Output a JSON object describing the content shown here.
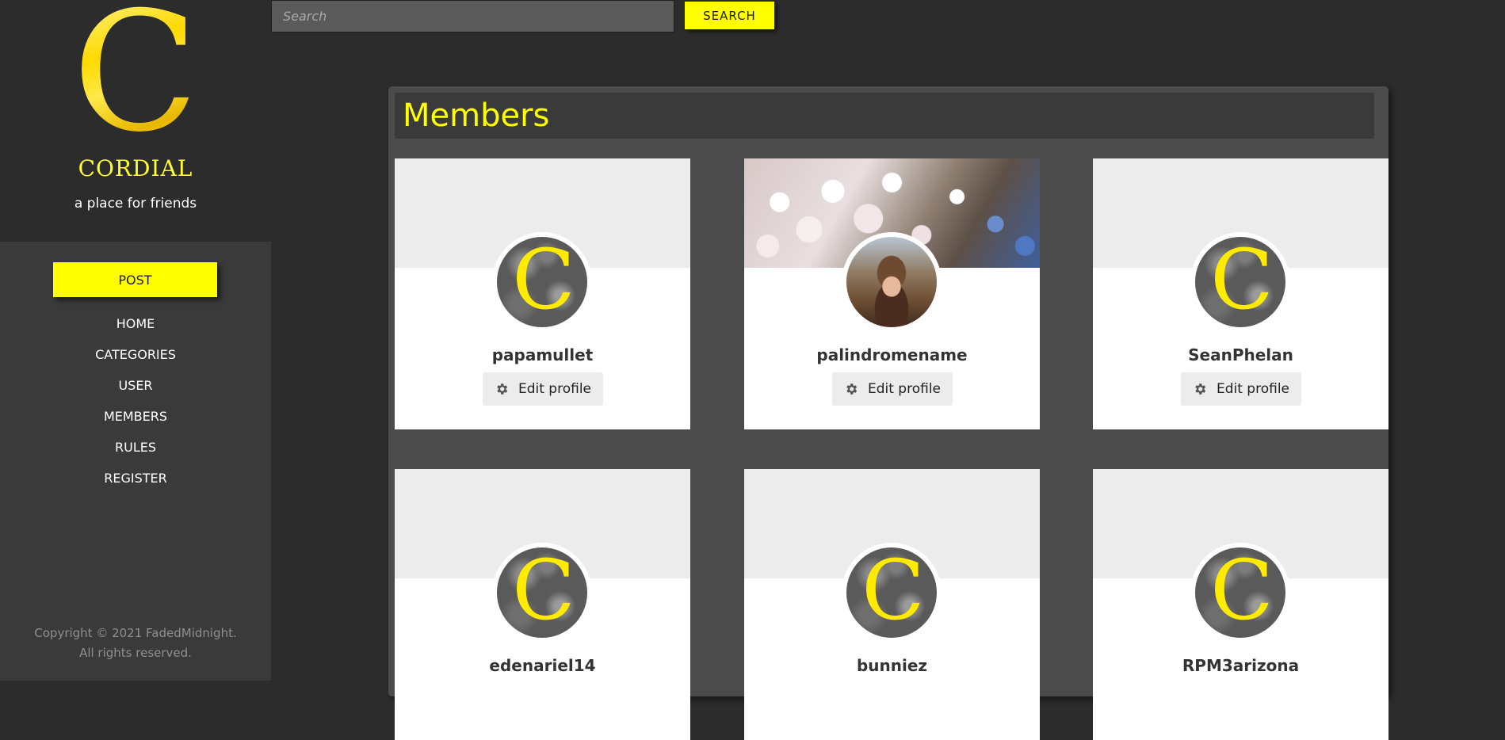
{
  "sidebar": {
    "logo_letter": "C",
    "site_name": "CORDIAL",
    "tagline": "a place for friends",
    "post_label": "POST",
    "nav": [
      {
        "label": "HOME"
      },
      {
        "label": "CATEGORIES"
      },
      {
        "label": "USER"
      },
      {
        "label": "MEMBERS"
      },
      {
        "label": "RULES"
      },
      {
        "label": "REGISTER"
      }
    ],
    "copyright_line1": "Copyright © 2021 FadedMidnight.",
    "copyright_line2": "All rights reserved."
  },
  "search": {
    "placeholder": "Search",
    "button_label": "SEARCH"
  },
  "members": {
    "title": "Members",
    "edit_label": "Edit profile",
    "avatar_letter": "C",
    "cards": [
      {
        "username": "papamullet"
      },
      {
        "username": "palindromename"
      },
      {
        "username": "SeanPhelan"
      },
      {
        "username": "edenariel14"
      },
      {
        "username": "bunniez"
      },
      {
        "username": "RPM3arizona"
      }
    ]
  },
  "colors": {
    "accent": "#ffff00",
    "sidebar_bg": "#3a3a3a",
    "page_bg": "#2c2c2c",
    "panel_bg": "#4b4b4b"
  }
}
